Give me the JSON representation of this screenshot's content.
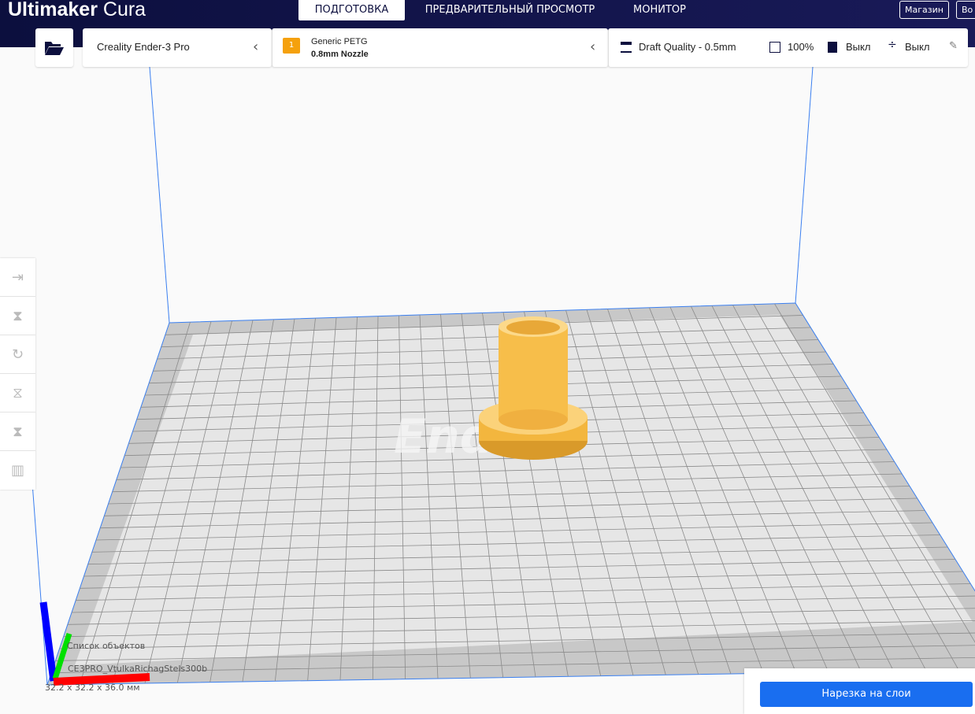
{
  "app": {
    "logo_bold": "Ultimaker",
    "logo_light": " Cura"
  },
  "nav": {
    "tabs": [
      {
        "label": "ПОДГОТОВКА",
        "active": true
      },
      {
        "label": "ПРЕДВАРИТЕЛЬНЫЙ ПРОСМОТР"
      },
      {
        "label": "МОНИТОР"
      }
    ],
    "marketplace": "Магазин",
    "signin": "Во"
  },
  "printer": {
    "name": "Creality Ender-3 Pro"
  },
  "material": {
    "extruder": "1",
    "name": "Generic PETG",
    "nozzle": "0.8mm Nozzle"
  },
  "settings": {
    "profile": "Draft Quality - 0.5mm",
    "infill": "100%",
    "support": "Выкл",
    "adhesion": "Выкл"
  },
  "objects": {
    "header": "Список объектов",
    "name": "CE3PRO_VtulkaRichagStels300b",
    "dimensions": "32.2 x 32.2 x 36.0 мм"
  },
  "slice": {
    "label": "Нарезка на слои"
  },
  "colors": {
    "topbar": "#0c0f3e",
    "accent": "#196ef0",
    "model": "#f9c74f"
  }
}
